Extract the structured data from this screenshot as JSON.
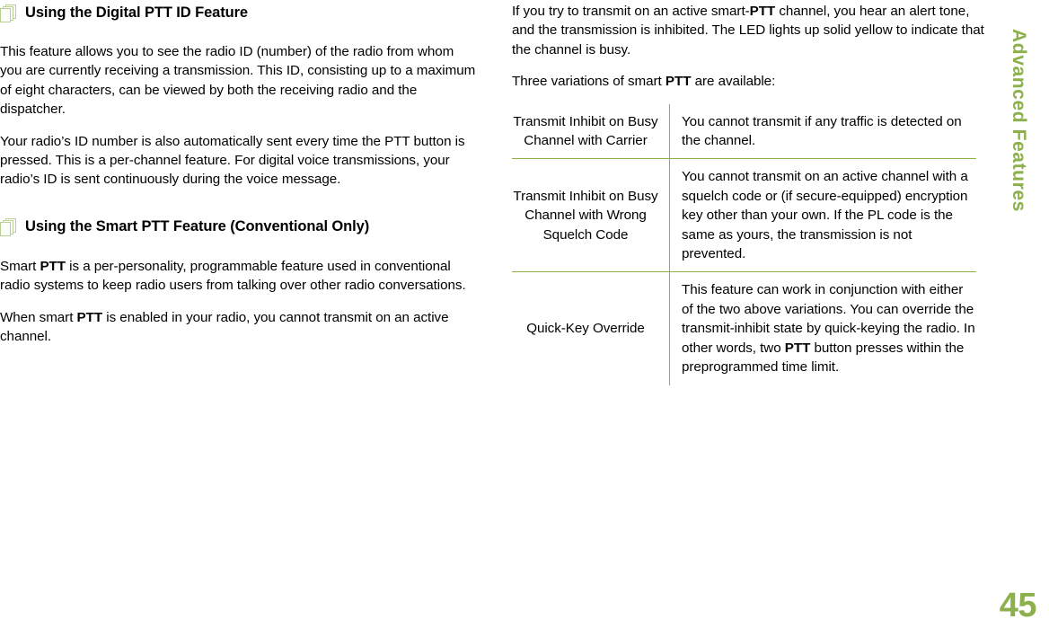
{
  "document": {
    "page_number": "45",
    "section_tab": "Advanced Features",
    "accent_color": "#8cb04b",
    "icon_color": "#b9cf93"
  },
  "left_column": {
    "heading_1": {
      "icon": "stacked-pages-icon",
      "text": "Using the Digital PTT ID Feature"
    },
    "paragraph_1": "This feature allows you to see the radio ID (number) of the radio from whom you are currently receiving a transmission. This ID, consisting up to a maximum of eight characters, can be viewed by both the receiving radio and the dispatcher.",
    "paragraph_2": "Your radio’s ID number is also automatically sent every time the PTT button is pressed. This is a per-channel feature. For digital voice transmissions, your radio’s ID is sent continuously during the voice message.",
    "heading_2": {
      "icon": "stacked-pages-icon",
      "text": "Using the Smart PTT Feature (Conventional Only)"
    },
    "paragraph_3_parts": {
      "a": "Smart ",
      "bold": "PTT",
      "b": " is a per-personality, programmable feature used in conventional radio systems to keep radio users from talking over other radio conversations."
    },
    "paragraph_4_parts": {
      "a": "When smart ",
      "bold": "PTT",
      "b": " is enabled in your radio, you cannot transmit on an active channel."
    }
  },
  "right_column": {
    "paragraph_1_parts": {
      "a": "If you try to transmit on an active smart-",
      "bold": "PTT",
      "b": " channel, you hear an alert tone, and the transmission is inhibited. The LED lights up solid yellow to indicate that the channel is busy."
    },
    "paragraph_2_parts": {
      "a": "Three variations of smart ",
      "bold": "PTT",
      "b": " are available:"
    },
    "table": {
      "rows": [
        {
          "name": "Transmit Inhibit on Busy Channel with Carrier",
          "description": "You cannot transmit if any traffic is detected on the channel."
        },
        {
          "name": "Transmit Inhibit on Busy Channel with Wrong Squelch Code",
          "description": "You cannot transmit on an active channel with a squelch code or (if secure-equipped) encryption key other than your own. If the PL code is the same as yours, the transmission is not prevented."
        },
        {
          "name": "Quick-Key Override",
          "description_parts": {
            "a": "This feature can work in conjunction with either of the two above variations. You can override the transmit-inhibit state by quick-keying the radio. In other words, two ",
            "bold": "PTT",
            "b": " button presses within the preprogrammed time limit."
          }
        }
      ]
    }
  }
}
